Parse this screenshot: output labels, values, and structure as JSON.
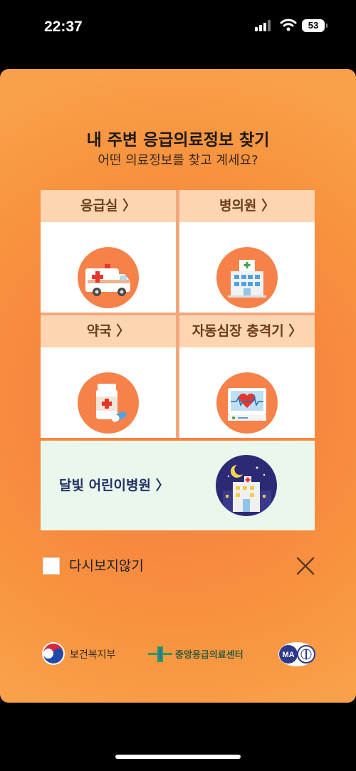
{
  "status_bar": {
    "time": "22:37",
    "battery": "53"
  },
  "modal": {
    "title": "내 주변 응급의료정보 찾기",
    "subtitle": "어떤 의료정보를 찾고 계세요?",
    "tiles": [
      {
        "label": "응급실 〉",
        "icon": "ambulance-icon"
      },
      {
        "label": "병의원 〉",
        "icon": "hospital-icon"
      },
      {
        "label": "약국 〉",
        "icon": "pill-bottle-icon"
      },
      {
        "label": "자동심장 충격기 〉",
        "icon": "defibrillator-icon"
      }
    ],
    "night_tile": {
      "label": "달빛 어린이병원 〉",
      "icon": "night-hospital-icon"
    },
    "dont_show_label": "다시보지않기",
    "logos": {
      "ministry": "보건복지부",
      "center": "중앙응급의료센터",
      "ma": "MA"
    }
  },
  "colors": {
    "accent": "#f6824a",
    "tile_header": "#fdd5b0",
    "night_bg": "#e9f7ec",
    "night_label": "#223067"
  }
}
